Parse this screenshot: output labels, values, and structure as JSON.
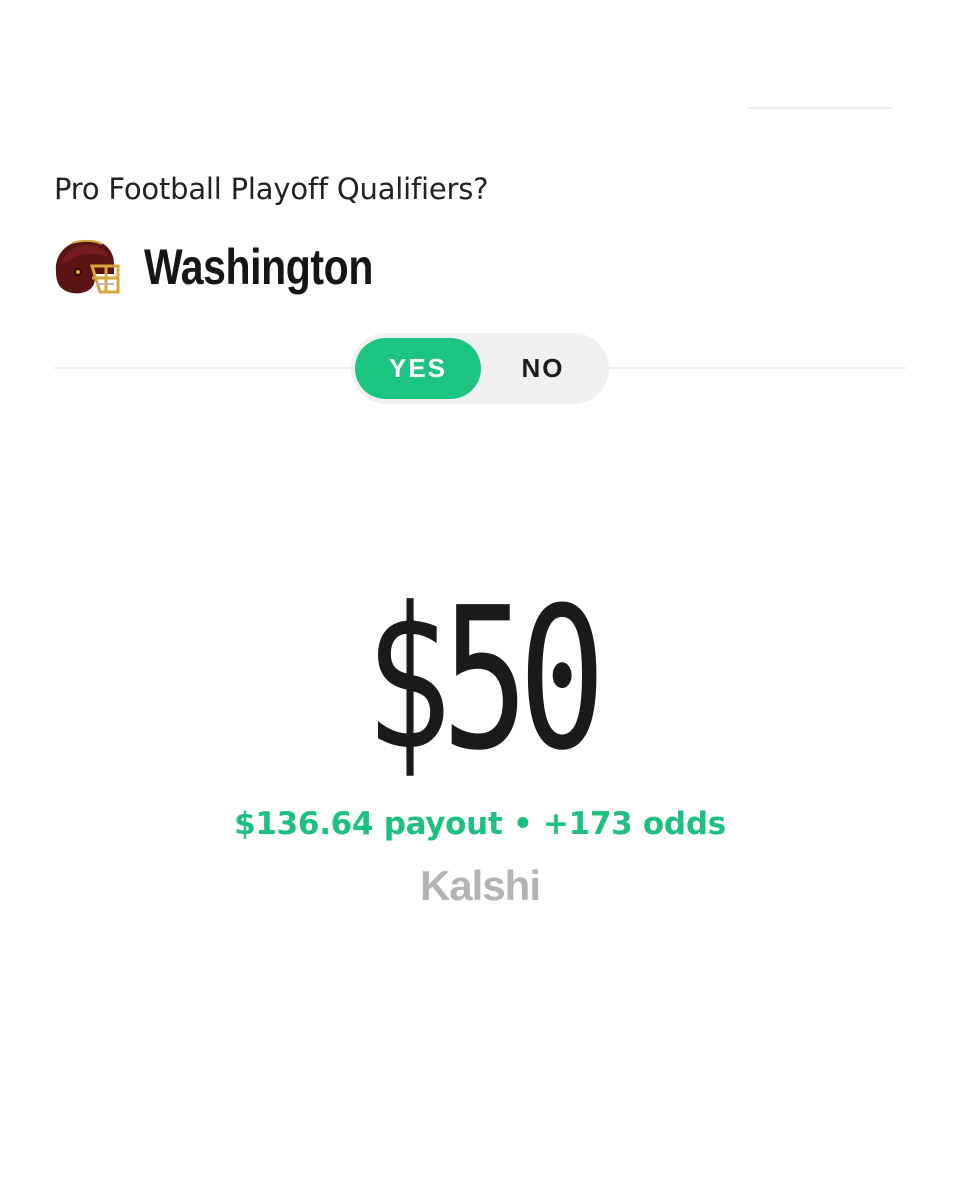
{
  "market": {
    "question": "Pro Football Playoff Qualifiers?",
    "team_name": "Washington",
    "team_icon": "football-helmet-icon"
  },
  "toggle": {
    "yes_label": "YES",
    "no_label": "NO",
    "selected": "YES"
  },
  "bet": {
    "amount": "$50",
    "payout_text": "$136.64 payout • +173 odds"
  },
  "brand": {
    "name": "Kalshi"
  },
  "colors": {
    "accent_green": "#1cc481",
    "helmet_burgundy": "#5a1414",
    "helmet_gold": "#d9a43a",
    "brand_gray": "#b3b3b3"
  }
}
